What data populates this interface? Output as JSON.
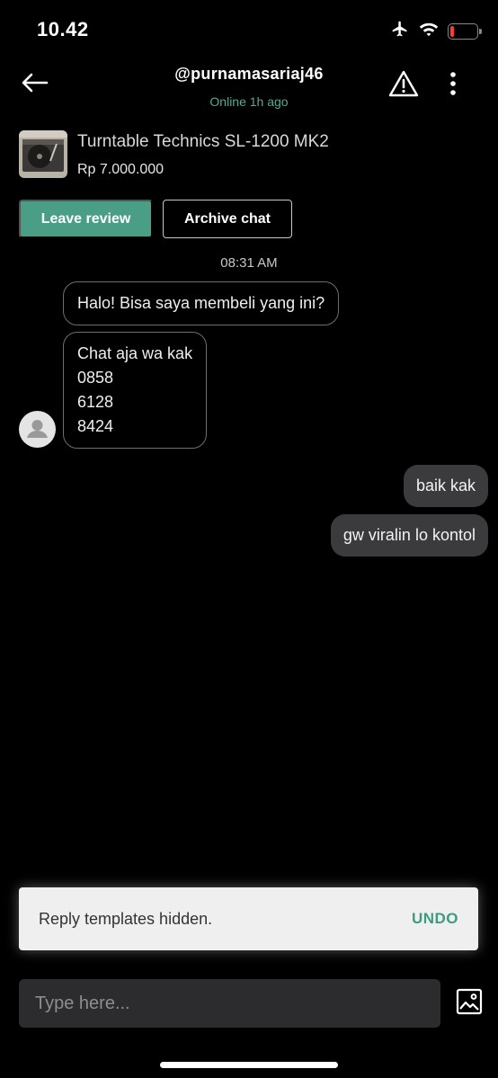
{
  "status_bar": {
    "time": "10.42",
    "icons": [
      "airplane-icon",
      "wifi-icon",
      "battery-icon"
    ],
    "battery_level": 0.15,
    "battery_color": "#ff3b30"
  },
  "header": {
    "username": "@purnamasariaj46",
    "status": "Online 1h ago",
    "back_icon": "arrow-left-icon",
    "report_icon": "warning-icon",
    "more_icon": "more-vertical-icon"
  },
  "product": {
    "name": "Turntable Technics SL-1200 MK2",
    "price": "Rp 7.000.000"
  },
  "actions": {
    "leave_review": "Leave review",
    "archive_chat": "Archive chat"
  },
  "chat": {
    "timestamp": "08:31 AM",
    "messages": [
      {
        "from": "me_other",
        "text": "Halo! Bisa saya membeli yang ini?"
      },
      {
        "from": "seller",
        "text": "Chat aja wa kak\n0858\n6128\n8424"
      },
      {
        "from": "me",
        "text": "baik kak"
      },
      {
        "from": "me",
        "text": "gw viralin lo kontol"
      }
    ]
  },
  "toast": {
    "message": "Reply templates hidden.",
    "action": "UNDO"
  },
  "composer": {
    "placeholder": "Type here...",
    "attach_icon": "image-gallery-icon"
  },
  "colors": {
    "accent": "#4b9e86",
    "online": "#4fae95",
    "background": "#000000",
    "bubble_out": "#3b3b3d"
  }
}
